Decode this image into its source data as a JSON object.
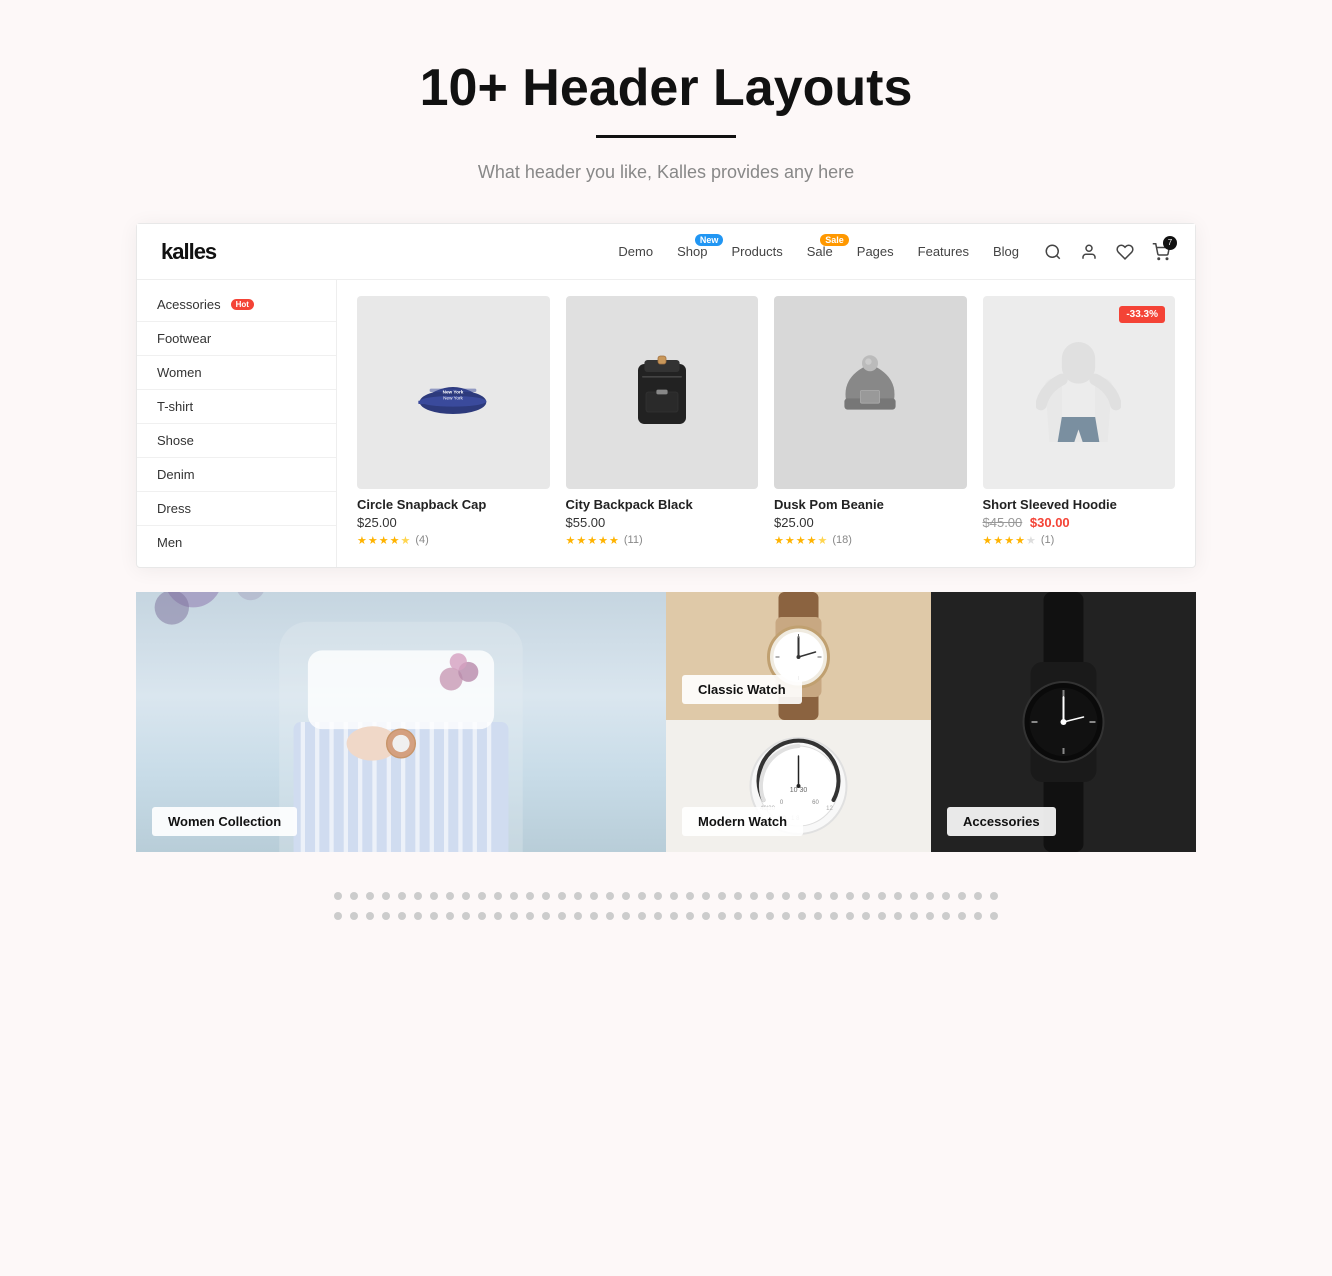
{
  "hero": {
    "title": "10+ Header Layouts",
    "subtitle": "What header you like, Kalles provides any here"
  },
  "header": {
    "logo": "kalles",
    "nav": [
      {
        "label": "Demo",
        "badge": null
      },
      {
        "label": "Shop",
        "badge": {
          "text": "New",
          "type": "new"
        }
      },
      {
        "label": "Products",
        "badge": null
      },
      {
        "label": "Sale",
        "badge": {
          "text": "Sale",
          "type": "sale"
        }
      },
      {
        "label": "Pages",
        "badge": null
      },
      {
        "label": "Features",
        "badge": null
      },
      {
        "label": "Blog",
        "badge": null
      }
    ],
    "cart_count": "7",
    "wishlist_count": "0"
  },
  "sidebar": {
    "items": [
      {
        "label": "Acessories",
        "badge": "Hot"
      },
      {
        "label": "Footwear",
        "badge": null
      },
      {
        "label": "Women",
        "badge": null
      },
      {
        "label": "T-shirt",
        "badge": null
      },
      {
        "label": "Shose",
        "badge": null
      },
      {
        "label": "Denim",
        "badge": null
      },
      {
        "label": "Dress",
        "badge": null
      },
      {
        "label": "Men",
        "badge": null
      }
    ]
  },
  "products": [
    {
      "name": "Circle Snapback Cap",
      "price": "$25.00",
      "old_price": null,
      "new_price": null,
      "stars": 4.5,
      "review_count": 4,
      "discount": null,
      "img_type": "cap"
    },
    {
      "name": "City Backpack Black",
      "price": "$55.00",
      "old_price": null,
      "new_price": null,
      "stars": 5,
      "review_count": 11,
      "discount": null,
      "img_type": "backpack"
    },
    {
      "name": "Dusk Pom Beanie",
      "price": "$25.00",
      "old_price": null,
      "new_price": null,
      "stars": 4.5,
      "review_count": 18,
      "discount": null,
      "img_type": "beanie"
    },
    {
      "name": "Short Sleeved Hoodie",
      "price": null,
      "old_price": "$45.00",
      "new_price": "$30.00",
      "stars": 4,
      "review_count": 1,
      "discount": "-33.3%",
      "img_type": "hoodie"
    }
  ],
  "collections": [
    {
      "label": "Women Collection",
      "type": "women"
    },
    {
      "label": "Classic Watch",
      "type": "classic-watch"
    },
    {
      "label": "Modern Watch",
      "type": "modern-watch"
    },
    {
      "label": "Accessories",
      "type": "accessories"
    }
  ],
  "dots": {
    "rows": 2,
    "per_row": 42
  }
}
